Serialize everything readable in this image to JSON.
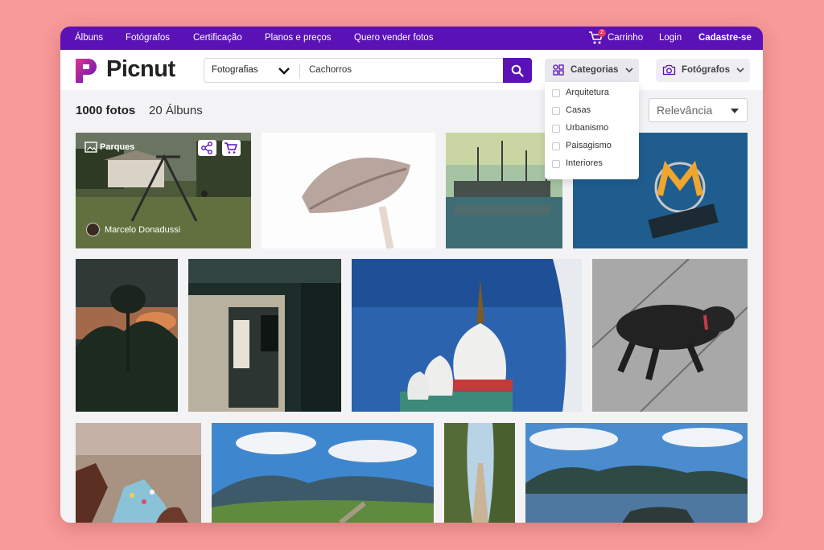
{
  "topbar": {
    "nav": [
      "Álbuns",
      "Fotógrafos",
      "Certificação",
      "Planos e preços",
      "Quero vender fotos"
    ],
    "cart_label": "Carrinho",
    "cart_count": "2",
    "login": "Login",
    "signup": "Cadastre-se"
  },
  "header": {
    "logo": "Picnut",
    "search_type": "Fotografias",
    "search_query": "Cachorros",
    "categories_label": "Categorias",
    "photographers_label": "Fotógrafos"
  },
  "categories_menu": [
    "Arquitetura",
    "Casas",
    "Urbanismo",
    "Paisagismo",
    "Interiores"
  ],
  "results": {
    "photos_count": "1000 fotos",
    "albums_count": "20 Álbuns",
    "sort_label": "Relevância"
  },
  "first_card": {
    "album": "Parques",
    "author": "Marcelo Donadussi"
  },
  "colors": {
    "brand": "#5a12b6",
    "background": "#f89a9a"
  }
}
